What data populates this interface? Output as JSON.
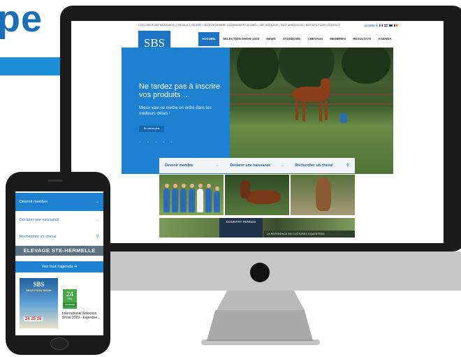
{
  "brand": {
    "partial_word": "pe",
    "color": "#1a6fb8",
    "accent": "#1d8fd6"
  },
  "site": {
    "top_menu": "| DÉCLARER UNE NAISSANCE | CHEVAUX À VENDRE | DEVENIR MEMBRE | COMMANDER UN LABEL | SBS MAGAZINE | TARIF ANNONCEUR | SBS INFO FLASH | CONTACT",
    "lang_label": "INTERS",
    "logo": {
      "title": "SBS",
      "subtitle": "STUDBOOK"
    },
    "nav": [
      "ACCUEIL",
      "SELECTION SHOW 2023",
      "NEWS",
      "STUDBOOK",
      "CHEVAUX",
      "MEMBRES",
      "RÉSULTATS",
      "AGENDA"
    ],
    "active_nav": "ACCUEIL",
    "hero": {
      "title": "Ne tardez pas à inscrire vos produits …",
      "subtitle": "Mieux vaut se mettre en ordre dans les meilleurs délais !",
      "button": "En savoir plus",
      "dots": "• • • • •"
    },
    "quick_links": [
      {
        "label": "Devenir membre",
        "icon": "→"
      },
      {
        "label": "Déclarer une naissance",
        "icon": "→"
      },
      {
        "label": "Rechercher un cheval",
        "icon": "⚲"
      }
    ],
    "banner": {
      "name": "COUNTRY FENCES",
      "tagline": "LA RÉFÉRENCE EN CLÔTURES ÉQUESTRES"
    }
  },
  "mobile": {
    "rows": [
      {
        "label": "Devenir membre",
        "icon": "→"
      },
      {
        "label": "Déclarer une naissance",
        "icon": "→"
      },
      {
        "label": "Rechercher un cheval",
        "icon": "⚲"
      }
    ],
    "elevage_banner": "ELEVAGE STE-HERMELLE",
    "agenda_button": "Voir tout l'agenda ➔",
    "poster": {
      "title": "SBS",
      "subtitle": "SELECTION SHOW",
      "dates": "24 25 26"
    },
    "event": {
      "day": "24",
      "month": "FÉV",
      "label": "JOURNÉE",
      "title": "International Selection Show 2023 - Expertise..."
    }
  }
}
